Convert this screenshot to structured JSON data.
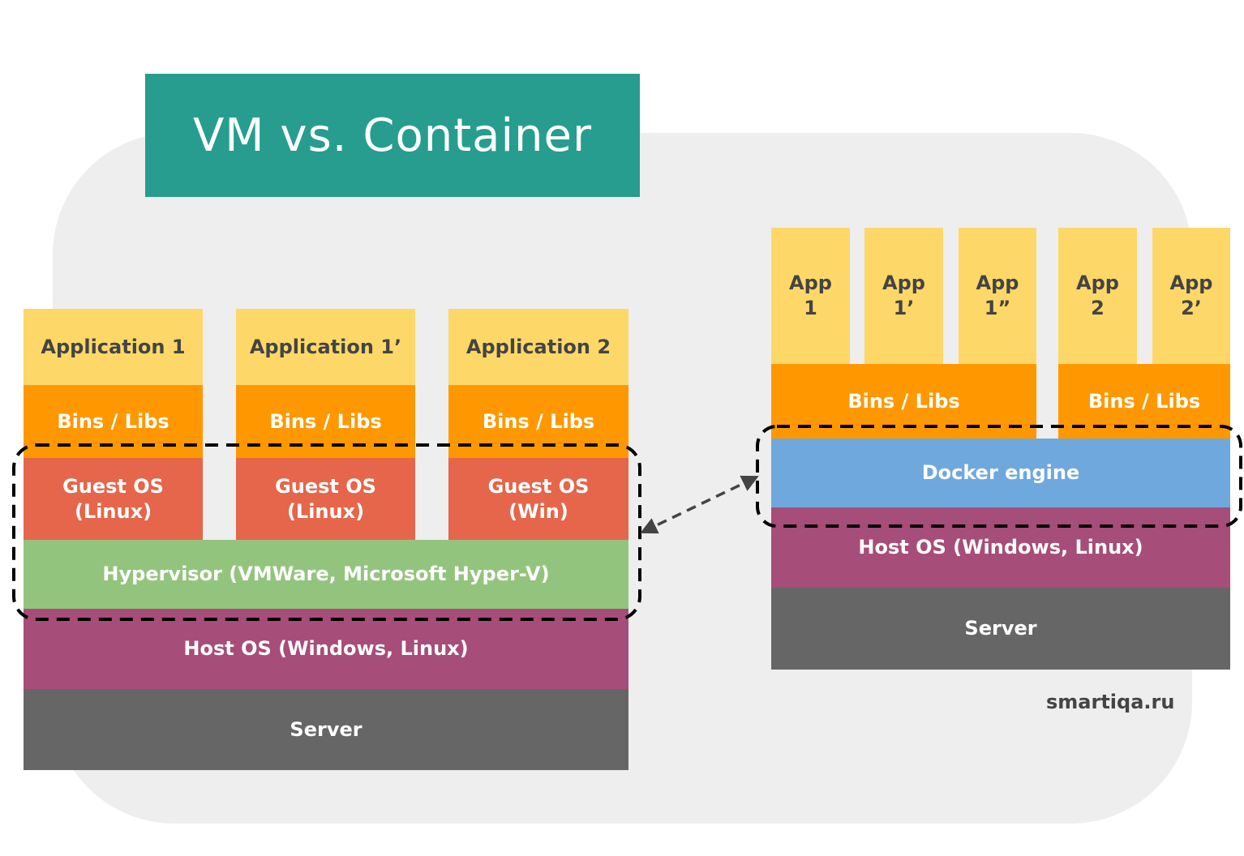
{
  "title": "VM vs. Container",
  "colors": {
    "title_bg": "#269d8f",
    "background_panel": "#eeeeee",
    "application": "#fdd868",
    "bins_libs": "#ff9800",
    "guest_os": "#e5664a",
    "hypervisor": "#93c47d",
    "docker_engine": "#6fa8dc",
    "host_os": "#a64d79",
    "server": "#666666"
  },
  "vm": {
    "applications": [
      "Application 1",
      "Application 1’",
      "Application 2"
    ],
    "bins_libs": [
      "Bins / Libs",
      "Bins / Libs",
      "Bins / Libs"
    ],
    "guest_os": [
      "Guest OS\n(Linux)",
      "Guest OS\n(Linux)",
      "Guest OS\n(Win)"
    ],
    "hypervisor": "Hypervisor (VMWare, Microsoft Hyper-V)",
    "host_os": "Host OS (Windows, Linux)",
    "server": "Server"
  },
  "container": {
    "apps": [
      "App\n1",
      "App\n1’",
      "App\n1”",
      "App\n2",
      "App\n2’"
    ],
    "bins_libs": [
      "Bins / Libs",
      "Bins / Libs"
    ],
    "docker_engine": "Docker engine",
    "host_os": "Host OS (Windows, Linux)",
    "server": "Server"
  },
  "watermark": "smartiqa.ru"
}
